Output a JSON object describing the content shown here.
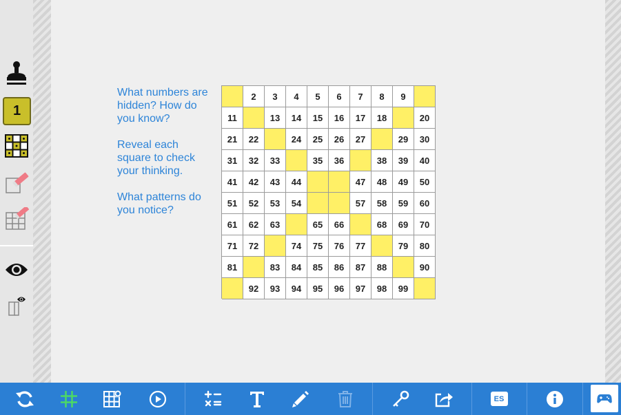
{
  "sidebar": {
    "number_tool_label": "1",
    "tools": [
      {
        "icon": "stamp-icon"
      },
      {
        "icon": "number-one-icon"
      },
      {
        "icon": "pattern-grid-icon"
      },
      {
        "icon": "erase-square-icon"
      },
      {
        "icon": "erase-grid-icon"
      },
      {
        "icon": "eye-icon"
      },
      {
        "icon": "reveal-square-icon"
      }
    ]
  },
  "instructions": {
    "line1": "What numbers are hidden? How do you know?",
    "line2": "Reveal each square to check your thinking.",
    "line3": "What patterns do you notice?"
  },
  "grid": {
    "hidden_numbers": [
      1,
      10,
      12,
      19,
      23,
      28,
      34,
      37,
      45,
      46,
      55,
      56,
      64,
      67,
      73,
      78,
      82,
      89,
      91,
      100
    ],
    "highlight_color": "#fff066"
  },
  "toolbar": {
    "language_label": "ES",
    "buttons": [
      "refresh-icon",
      "hash-grid-icon",
      "grid-settings-icon",
      "play-icon",
      "operations-icon",
      "text-icon",
      "pencil-icon",
      "trash-icon",
      "key-icon",
      "share-icon",
      "language-icon",
      "info-icon",
      "gamepad-icon"
    ]
  },
  "colors": {
    "accent_blue": "#2b7fd4",
    "instruction_text": "#2d84d8",
    "active_tool": "#c9bf2a",
    "green_icon": "#4cd964"
  }
}
